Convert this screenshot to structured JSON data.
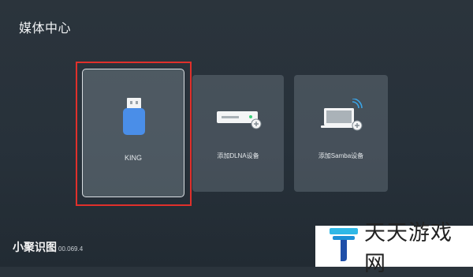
{
  "page": {
    "title": "媒体中心"
  },
  "devices": [
    {
      "label": "KING",
      "icon": "usb-drive-icon",
      "selected": true
    },
    {
      "label": "添加DLNA设备",
      "icon": "dlna-device-add-icon",
      "selected": false
    },
    {
      "label": "添加Samba设备",
      "icon": "samba-laptop-add-icon",
      "selected": false
    }
  ],
  "footer": {
    "brand": "小聚识图",
    "version": "00.069.4"
  },
  "watermark": {
    "text": "天天游戏网",
    "logo": "t-logo-icon"
  },
  "colors": {
    "selection": "#e0302b",
    "usb": "#4a8ee8",
    "accent_green": "#3ad07a"
  }
}
